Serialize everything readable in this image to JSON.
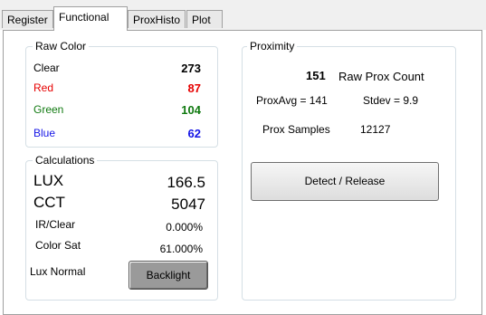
{
  "tabs": [
    "Register",
    "Functional",
    "ProxHisto",
    "Plot"
  ],
  "raw_color": {
    "title": "Raw Color",
    "clear": {
      "label": "Clear",
      "value": "273",
      "color": "#000000"
    },
    "red": {
      "label": "Red",
      "value": "87",
      "color": "#e60000"
    },
    "green": {
      "label": "Green",
      "value": "104",
      "color": "#117a11"
    },
    "blue": {
      "label": "Blue",
      "value": "62",
      "color": "#1515e6"
    }
  },
  "calculations": {
    "title": "Calculations",
    "lux_label": "LUX",
    "lux_value": "166.5",
    "cct_label": "CCT",
    "cct_value": "5047",
    "irclear_label": "IR/Clear",
    "irclear_value": "0.000%",
    "colorsat_label": "Color Sat",
    "colorsat_value": "61.000%",
    "lux_normal_label": "Lux Normal",
    "backlight_button": "Backlight"
  },
  "proximity": {
    "title": "Proximity",
    "raw_count_value": "151",
    "raw_count_label": "Raw Prox Count",
    "prox_avg": "ProxAvg = 141",
    "stdev": "Stdev = 9.9",
    "samples_label": "Prox Samples",
    "samples_value": "12127",
    "detect_button": "Detect / Release"
  }
}
